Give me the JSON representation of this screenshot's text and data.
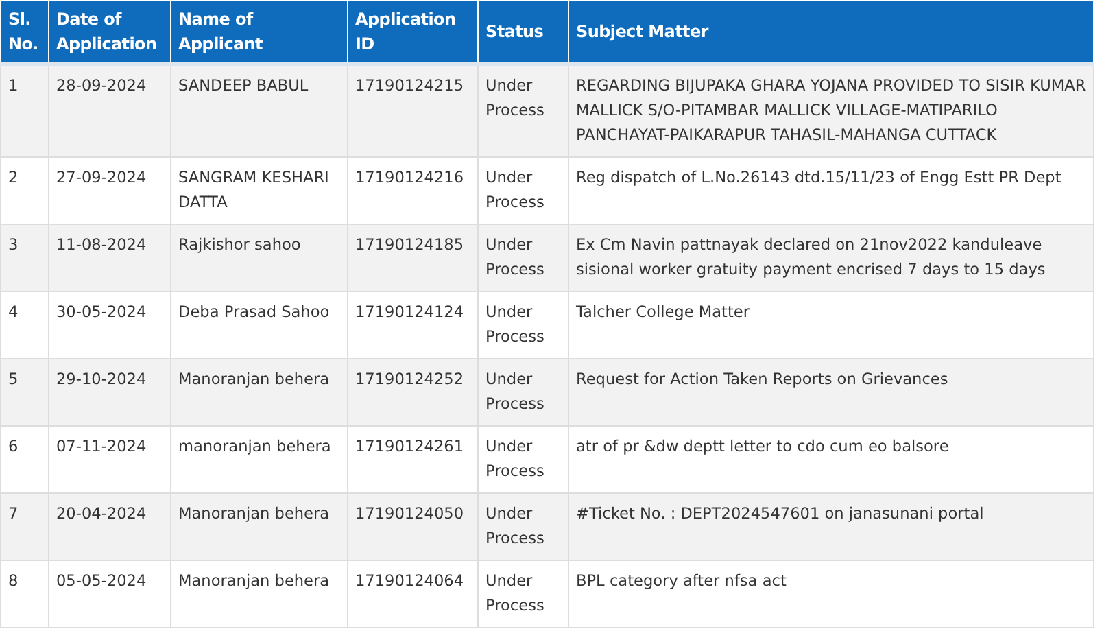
{
  "table": {
    "columns": [
      "Sl. No.",
      "Date of Application",
      "Name of Applicant",
      "Application ID",
      "Status",
      "Subject Matter"
    ],
    "rows": [
      [
        "1",
        "28-09-2024",
        "SANDEEP BABUL",
        "17190124215",
        "Under Process",
        "REGARDING BIJUPAKA GHARA YOJANA PROVIDED TO SISIR KUMAR MALLICK S/O-PITAMBAR MALLICK VILLAGE-MATIPARILO PANCHAYAT-PAIKARAPUR TAHASIL-MAHANGA CUTTACK"
      ],
      [
        "2",
        "27-09-2024",
        "SANGRAM KESHARI DATTA",
        "17190124216",
        "Under Process",
        "Reg dispatch of L.No.26143 dtd.15/11/23 of Engg Estt PR Dept"
      ],
      [
        "3",
        "11-08-2024",
        "Rajkishor sahoo",
        "17190124185",
        "Under Process",
        "Ex Cm Navin pattnayak declared on 21nov2022 kanduleave sisional worker gratuity payment encrised 7 days to 15 days"
      ],
      [
        "4",
        "30-05-2024",
        "Deba Prasad Sahoo",
        "17190124124",
        "Under Process",
        "Talcher College Matter"
      ],
      [
        "5",
        "29-10-2024",
        "Manoranjan behera",
        "17190124252",
        "Under Process",
        "Request for Action Taken Reports on Grievances"
      ],
      [
        "6",
        "07-11-2024",
        "manoranjan behera",
        "17190124261",
        "Under Process",
        "atr of pr &dw deptt letter to cdo cum eo balsore"
      ],
      [
        "7",
        "20-04-2024",
        "Manoranjan behera",
        "17190124050",
        "Under Process",
        "#Ticket No. : DEPT2024547601 on janasunani portal"
      ],
      [
        "8",
        "05-05-2024",
        "Manoranjan behera",
        "17190124064",
        "Under Process",
        "BPL category after nfsa act"
      ]
    ]
  }
}
